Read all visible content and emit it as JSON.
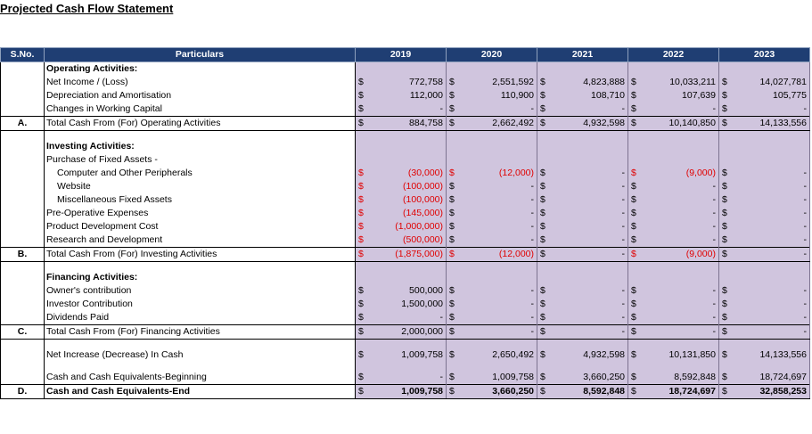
{
  "title": "Projected Cash Flow Statement",
  "headers": {
    "sno": "S.No.",
    "particulars": "Particulars",
    "years": [
      "2019",
      "2020",
      "2021",
      "2022",
      "2023"
    ]
  },
  "currency": "$",
  "operating": {
    "heading": "Operating Activities:",
    "rows": [
      {
        "label": "Net Income / (Loss)",
        "values": [
          "772,758",
          "2,551,592",
          "4,823,888",
          "10,033,211",
          "14,027,781"
        ]
      },
      {
        "label": "Depreciation and Amortisation",
        "values": [
          "112,000",
          "110,900",
          "108,710",
          "107,639",
          "105,775"
        ]
      },
      {
        "label": "Changes in Working Capital",
        "values": [
          "-",
          "-",
          "-",
          "-",
          "-"
        ]
      }
    ],
    "total": {
      "sno": "A.",
      "label": "Total Cash From (For) Operating Activities",
      "values": [
        "884,758",
        "2,662,492",
        "4,932,598",
        "10,140,850",
        "14,133,556"
      ]
    }
  },
  "investing": {
    "heading": "Investing Activities:",
    "subheading": "Purchase of Fixed Assets -",
    "rows": [
      {
        "label": "Computer and Other Peripherals",
        "values": [
          "(30,000)",
          "(12,000)",
          "-",
          "(9,000)",
          "-"
        ]
      },
      {
        "label": "Website",
        "values": [
          "(100,000)",
          "-",
          "-",
          "-",
          "-"
        ]
      },
      {
        "label": "Miscellaneous Fixed Assets",
        "values": [
          "(100,000)",
          "-",
          "-",
          "-",
          "-"
        ]
      },
      {
        "label": "Pre-Operative Expenses",
        "values": [
          "(145,000)",
          "-",
          "-",
          "-",
          "-"
        ]
      },
      {
        "label": "Product Development Cost",
        "values": [
          "(1,000,000)",
          "-",
          "-",
          "-",
          "-"
        ]
      },
      {
        "label": "Research and Development",
        "values": [
          "(500,000)",
          "-",
          "-",
          "-",
          "-"
        ]
      }
    ],
    "total": {
      "sno": "B.",
      "label": "Total Cash From (For) Investing Activities",
      "values": [
        "(1,875,000)",
        "(12,000)",
        "-",
        "(9,000)",
        "-"
      ]
    }
  },
  "financing": {
    "heading": "Financing Activities:",
    "rows": [
      {
        "label": "Owner's contribution",
        "values": [
          "500,000",
          "-",
          "-",
          "-",
          "-"
        ]
      },
      {
        "label": "Investor Contribution",
        "values": [
          "1,500,000",
          "-",
          "-",
          "-",
          "-"
        ]
      },
      {
        "label": "Dividends Paid",
        "values": [
          "-",
          "-",
          "-",
          "-",
          "-"
        ]
      }
    ],
    "total": {
      "sno": "C.",
      "label": "Total Cash From (For) Financing Activities",
      "values": [
        "2,000,000",
        "-",
        "-",
        "-",
        "-"
      ]
    }
  },
  "net_increase": {
    "label": "Net Increase (Decrease) In Cash",
    "values": [
      "1,009,758",
      "2,650,492",
      "4,932,598",
      "10,131,850",
      "14,133,556"
    ]
  },
  "beginning": {
    "label": "Cash and Cash Equivalents-Beginning",
    "values": [
      "-",
      "1,009,758",
      "3,660,250",
      "8,592,848",
      "18,724,697"
    ]
  },
  "ending": {
    "sno": "D.",
    "label": "Cash and Cash Equivalents-End",
    "values": [
      "1,009,758",
      "3,660,250",
      "8,592,848",
      "18,724,697",
      "32,858,253"
    ]
  },
  "colors": {
    "header_bg": "#1f3e73",
    "cell_bg": "#d0c5de",
    "negative": "#e00000"
  }
}
